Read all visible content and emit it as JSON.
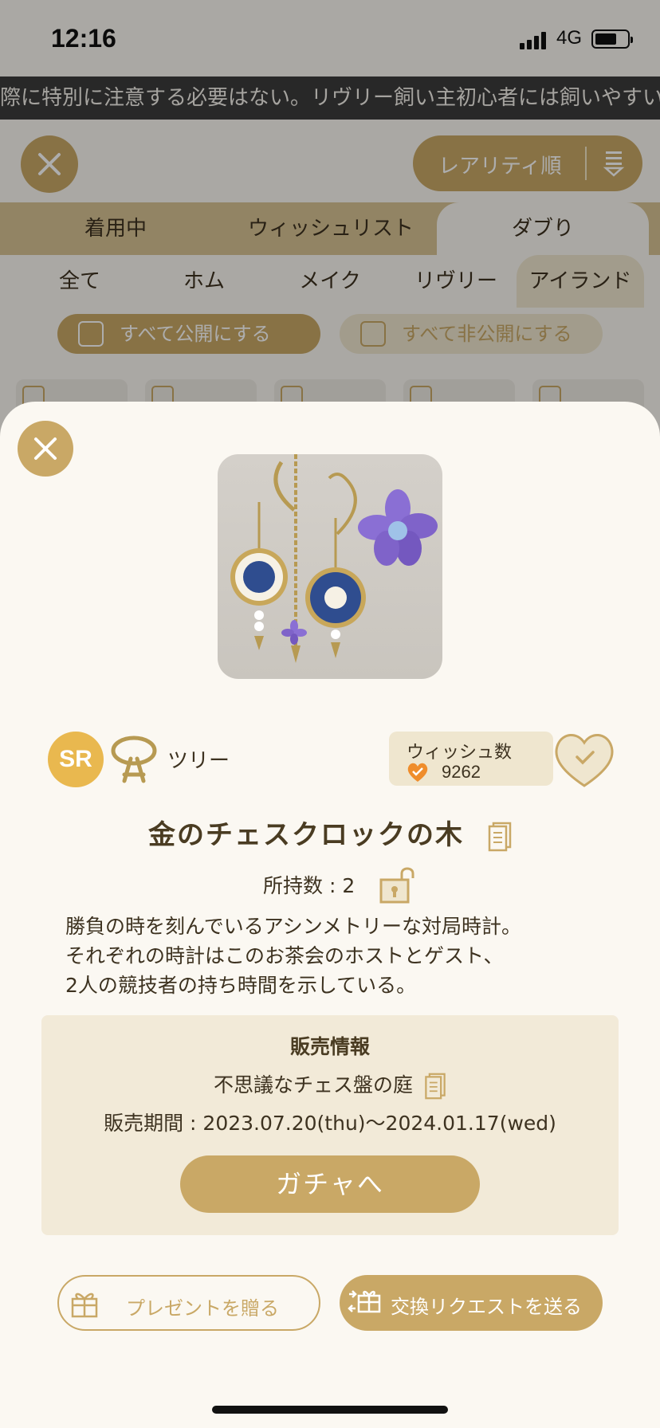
{
  "status_bar": {
    "time": "12:16",
    "network": "4G"
  },
  "ticker": {
    "text": "際に特別に注意する必要はない。リヴリー飼い主初心者には飼いやすい"
  },
  "toolbar": {
    "sort_label": "レアリティ順"
  },
  "tabs_primary": [
    {
      "label": "着用中",
      "selected": false
    },
    {
      "label": "ウィッシュリスト",
      "selected": false
    },
    {
      "label": "ダブり",
      "selected": true
    }
  ],
  "tabs_secondary": [
    {
      "label": "全て",
      "selected": false
    },
    {
      "label": "ホム",
      "selected": false
    },
    {
      "label": "メイク",
      "selected": false
    },
    {
      "label": "リヴリー",
      "selected": false
    },
    {
      "label": "アイランド",
      "selected": true
    }
  ],
  "visibility": {
    "publish_all": "すべて公開にする",
    "unpublish_all": "すべて非公開にする"
  },
  "item": {
    "rarity": "SR",
    "category": "ツリー",
    "wish_label": "ウィッシュ数",
    "wish_count": "9262",
    "name": "金のチェスクロックの木",
    "owned": "所持数 : 2",
    "description": [
      "勝負の時を刻んでいるアシンメトリーな対局時計。",
      "それぞれの時計はこのお茶会のホストとゲスト、",
      "2人の競技者の持ち時間を示している。"
    ]
  },
  "sales": {
    "heading": "販売情報",
    "gacha_name": "不思議なチェス盤の庭",
    "period": "販売期間 : 2023.07.20(thu)〜2024.01.17(wed)",
    "gacha_button": "ガチャへ"
  },
  "actions": {
    "gift": "プレゼントを贈る",
    "trade": "交換リクエストを送る"
  },
  "colors": {
    "accent": "#c9a866",
    "rarity_sr": "#e9b84f",
    "panel": "#f2ead8",
    "background": "#fbf8f2"
  }
}
